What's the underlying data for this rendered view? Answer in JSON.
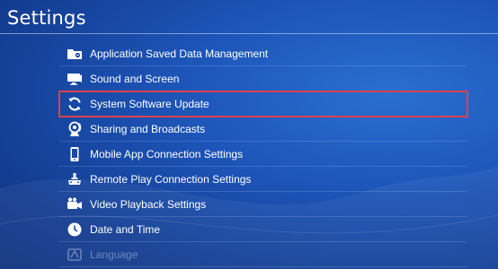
{
  "header": {
    "title": "Settings"
  },
  "menu": {
    "items": [
      {
        "label": "Application Saved Data Management",
        "icon": "saved-data-icon"
      },
      {
        "label": "Sound and Screen",
        "icon": "sound-screen-icon"
      },
      {
        "label": "System Software Update",
        "icon": "refresh-icon",
        "selected": true
      },
      {
        "label": "Sharing and Broadcasts",
        "icon": "broadcast-icon"
      },
      {
        "label": "Mobile App Connection Settings",
        "icon": "mobile-phone-icon"
      },
      {
        "label": "Remote Play Connection Settings",
        "icon": "remote-play-icon"
      },
      {
        "label": "Video Playback Settings",
        "icon": "video-camera-icon"
      },
      {
        "label": "Date and Time",
        "icon": "clock-icon"
      },
      {
        "label": "Language",
        "icon": "language-icon"
      }
    ]
  },
  "colors": {
    "highlight_border": "#d9424f",
    "background_dark": "#0b2668",
    "background_light": "#2a6fd0"
  }
}
